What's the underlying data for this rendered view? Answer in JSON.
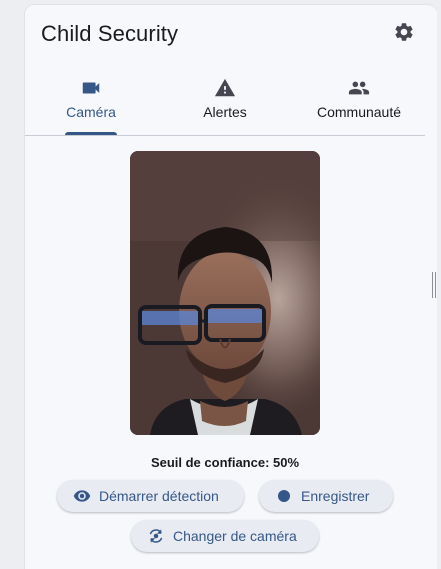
{
  "header": {
    "title": "Child Security",
    "settings_icon": "gear-icon"
  },
  "tabs": [
    {
      "label": "Caméra",
      "icon": "videocam-icon",
      "active": true
    },
    {
      "label": "Alertes",
      "icon": "warning-icon",
      "active": false
    },
    {
      "label": "Communauté",
      "icon": "people-icon",
      "active": false
    }
  ],
  "camera": {
    "threshold_text": "Seuil de confiance: 50%"
  },
  "actions": {
    "start_detection": {
      "label": "Démarrer détection",
      "icon": "eye-icon"
    },
    "record": {
      "label": "Enregistrer",
      "icon": "record-dot-icon"
    },
    "switch_camera": {
      "label": "Changer de caméra",
      "icon": "switch-camera-icon"
    }
  },
  "colors": {
    "accent": "#355787",
    "text": "#1b1b1f",
    "surface": "#f7f8fc",
    "button_bg": "#e9ebf2"
  }
}
